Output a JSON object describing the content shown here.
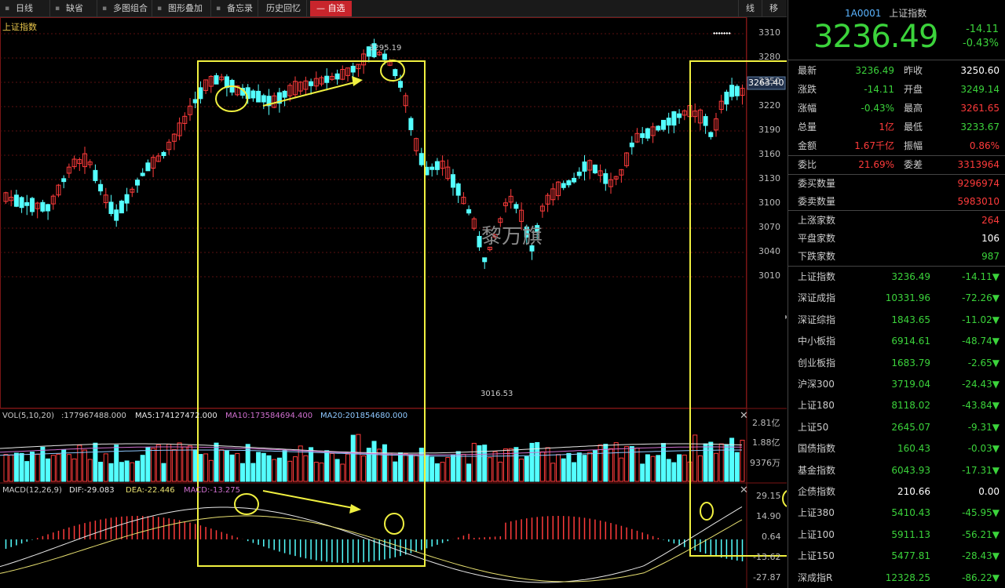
{
  "toolbar": {
    "items": [
      "日线",
      "缺省",
      "多图组合",
      "图形叠加",
      "备忘录",
      "历史回忆"
    ],
    "selected": "— 自选",
    "right_items": [
      "线",
      "移"
    ]
  },
  "chart": {
    "title": "上证指数",
    "price_axis": [
      "3310",
      "3280",
      "3250",
      "3220",
      "3190",
      "3160",
      "3130",
      "3100",
      "3070",
      "3040",
      "3010"
    ],
    "current_price_tag": "3263.40",
    "high_label": "3295.19",
    "low_label": "3016.53",
    "watermark": "黎万旗",
    "vol": {
      "name": "VOL(5,10,20)",
      "value": ":177967488.000",
      "ma5": "MA5:174127472.000",
      "ma10": "MA10:173584694.400",
      "ma20": "MA20:201854680.000",
      "axis": [
        "2.81亿",
        "1.88亿",
        "9376万"
      ]
    },
    "macd": {
      "name": "MACD(12,26,9)",
      "dif": "DIF:-29.083",
      "dea": "DEA:-22.446",
      "macd": "MACD:-13.275",
      "axis": [
        "29.15",
        "14.90",
        "0.64",
        "-13.62",
        "-27.87"
      ]
    }
  },
  "panel": {
    "code": "1A0001",
    "name": "上证指数",
    "price": "3236.49",
    "change": "-14.11",
    "change_pct": "-0.43%",
    "quote": [
      [
        "最新",
        "3236.49",
        "green",
        "昨收",
        "3250.60",
        "white"
      ],
      [
        "涨跌",
        "-14.11",
        "green",
        "开盘",
        "3249.14",
        "green"
      ],
      [
        "涨幅",
        "-0.43%",
        "green",
        "最高",
        "3261.65",
        "red"
      ],
      [
        "总量",
        "1亿",
        "red",
        "最低",
        "3233.67",
        "green"
      ],
      [
        "金额",
        "1.67千亿",
        "red",
        "振幅",
        "0.86%",
        "red"
      ]
    ],
    "weibi": [
      "委比",
      "21.69%",
      "委差",
      "3313964"
    ],
    "orders": [
      [
        "委买数量",
        "9296974"
      ],
      [
        "委卖数量",
        "5983010"
      ]
    ],
    "breadth": [
      [
        "上涨家数",
        "264",
        "red"
      ],
      [
        "平盘家数",
        "106",
        "white"
      ],
      [
        "下跌家数",
        "987",
        "green"
      ]
    ],
    "indices": [
      [
        "上证指数",
        "3236.49",
        "green",
        "-14.11▼",
        "green"
      ],
      [
        "深证成指",
        "10331.96",
        "green",
        "-72.26▼",
        "green"
      ],
      [
        "深证综指",
        "1843.65",
        "green",
        "-11.02▼",
        "green"
      ],
      [
        "中小板指",
        "6914.61",
        "green",
        "-48.74▼",
        "green"
      ],
      [
        "创业板指",
        "1683.79",
        "green",
        "-2.65▼",
        "green"
      ],
      [
        "沪深300",
        "3719.04",
        "green",
        "-24.43▼",
        "green"
      ],
      [
        "上证180",
        "8118.02",
        "green",
        "-43.84▼",
        "green"
      ],
      [
        "上证50",
        "2645.07",
        "green",
        "-9.31▼",
        "green"
      ],
      [
        "国债指数",
        "160.43",
        "green",
        "-0.03▼",
        "green"
      ],
      [
        "基金指数",
        "6043.93",
        "green",
        "-17.31▼",
        "green"
      ],
      [
        "企债指数",
        "210.66",
        "white",
        "0.00",
        "white"
      ],
      [
        "上证380",
        "5410.43",
        "green",
        "-45.95▼",
        "green"
      ],
      [
        "上证100",
        "5911.13",
        "green",
        "-56.21▼",
        "green"
      ],
      [
        "上证150",
        "5477.81",
        "green",
        "-28.43▼",
        "green"
      ],
      [
        "深成指R",
        "12328.25",
        "green",
        "-86.22▼",
        "green"
      ]
    ]
  },
  "colors": {
    "up": "#ff3b3b",
    "down": "#54ffff",
    "highlight": "#f0f040"
  }
}
